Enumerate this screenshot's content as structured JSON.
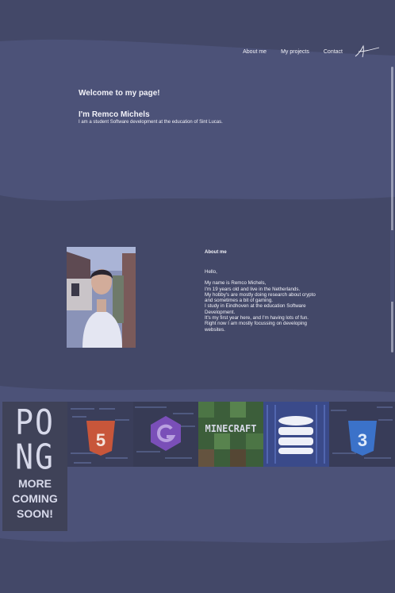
{
  "nav": {
    "items": [
      {
        "label": "About me"
      },
      {
        "label": "My projects"
      },
      {
        "label": "Contact"
      }
    ]
  },
  "hero": {
    "welcome": "Welcome to my page!",
    "name": "I'm Remco Michels",
    "tagline": "I am a student Software development at the education of Sint Lucas."
  },
  "about": {
    "title": "About me",
    "greeting": "Hello,",
    "lines": [
      "My name is Remco Michels,",
      "I'm 19 years old and live in the Netherlands.",
      "My hobby's are mostly doing research about crypto and sometimes a bit of gaming.",
      "I study in Eindhoven at the education Software Development.",
      "It's my first year here, and I'm having lots of fun.",
      "Right now I am mostly focussing on developing websites."
    ]
  },
  "projects": {
    "pong_word_1": "PO",
    "pong_word_2": "NG",
    "more_1": "MORE",
    "more_2": "COMING",
    "more_3": "SOON!",
    "minecraft_label": "MINECRAFT",
    "html_label": "5",
    "css_label": "3"
  },
  "colors": {
    "page_bg": "#434868",
    "band_bg": "#4c5278",
    "html5": "#c8563a",
    "css3": "#3b72c9",
    "game": "#7a4fb8"
  }
}
